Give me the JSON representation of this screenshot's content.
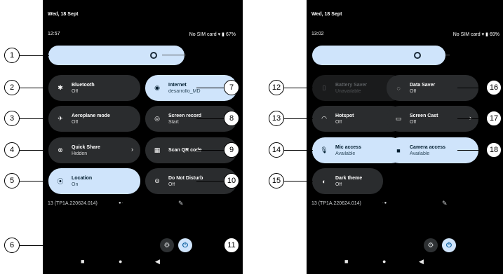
{
  "phone1": {
    "date": "Wed, 18 Sept",
    "time": "12:57",
    "status": "No SIM card",
    "battery": "67%",
    "tiles": [
      {
        "icon": "bluetooth-icon",
        "glyph": "✱",
        "label": "Bluetooth",
        "sub": "Off",
        "state": "off",
        "chevron": false
      },
      {
        "icon": "wifi-icon",
        "glyph": "◉",
        "label": "Internet",
        "sub": "desarrollo_MD",
        "state": "on",
        "chevron": true
      },
      {
        "icon": "airplane-icon",
        "glyph": "✈",
        "label": "Aeroplane mode",
        "sub": "Off",
        "state": "off",
        "chevron": false
      },
      {
        "icon": "screen-record-icon",
        "glyph": "◎",
        "label": "Screen record",
        "sub": "Start",
        "state": "off",
        "chevron": true
      },
      {
        "icon": "quick-share-icon",
        "glyph": "⊗",
        "label": "Quick Share",
        "sub": "Hidden",
        "state": "off",
        "chevron": true
      },
      {
        "icon": "qr-code-icon",
        "glyph": "▦",
        "label": "Scan QR code",
        "sub": "",
        "state": "off",
        "chevron": true
      },
      {
        "icon": "location-icon",
        "glyph": "⦿",
        "label": "Location",
        "sub": "On",
        "state": "on",
        "chevron": false
      },
      {
        "icon": "do-not-disturb-icon",
        "glyph": "⊖",
        "label": "Do Not Disturb",
        "sub": "Off",
        "state": "off",
        "chevron": false
      }
    ],
    "build": "13 (TP1A.220624.014)"
  },
  "phone2": {
    "date": "Wed, 18 Sept",
    "time": "13:02",
    "status": "No SIM card",
    "battery": "69%",
    "tiles": [
      {
        "icon": "battery-saver-icon",
        "glyph": "▯",
        "label": "Battery Saver",
        "sub": "Unavailable",
        "state": "dim",
        "chevron": false
      },
      {
        "icon": "data-saver-icon",
        "glyph": "◌",
        "label": "Data Saver",
        "sub": "Off",
        "state": "off",
        "chevron": false
      },
      {
        "icon": "hotspot-icon",
        "glyph": "◠",
        "label": "Hotspot",
        "sub": "Off",
        "state": "off",
        "chevron": false
      },
      {
        "icon": "screen-cast-icon",
        "glyph": "▭",
        "label": "Screen Cast",
        "sub": "Off",
        "state": "off",
        "chevron": true
      },
      {
        "icon": "microphone-icon",
        "glyph": "🎙",
        "label": "Mic access",
        "sub": "Available",
        "state": "on",
        "chevron": false
      },
      {
        "icon": "camera-icon",
        "glyph": "■",
        "label": "Camera access",
        "sub": "Available",
        "state": "on",
        "chevron": false
      },
      {
        "icon": "dark-theme-icon",
        "glyph": "◐",
        "label": "Dark theme",
        "sub": "Off",
        "state": "off",
        "chevron": false
      }
    ],
    "build": "13 (TP1A.220624.014)"
  },
  "chevron_glyph": "›",
  "callouts": [
    "1",
    "2",
    "3",
    "4",
    "5",
    "6",
    "7",
    "8",
    "9",
    "10",
    "11",
    "12",
    "13",
    "14",
    "15",
    "16",
    "17",
    "18"
  ],
  "colors": {
    "active_tile": "#cfe4fb",
    "inactive_tile": "#2a2c2e",
    "phone_bg": "#000000",
    "accent": "#005a9c"
  }
}
